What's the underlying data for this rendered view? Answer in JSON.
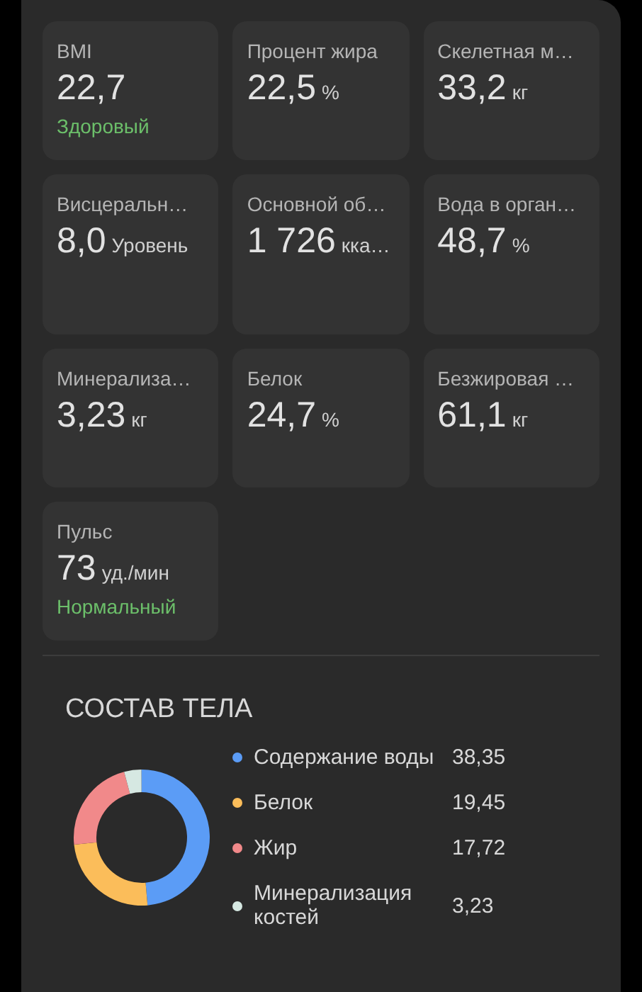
{
  "metrics": [
    {
      "label": "BMI",
      "value": "22,7",
      "status": "Здоровый"
    },
    {
      "label": "Процент жира",
      "value": "22,5",
      "unit": "%"
    },
    {
      "label": "Скелетная м…",
      "value": "33,2",
      "unit": "кг"
    },
    {
      "label": "Висцеральн…",
      "value": "8,0",
      "unit": "Уровень"
    },
    {
      "label": "Основной об…",
      "value": "1 726",
      "unit": "кка…"
    },
    {
      "label": "Вода в орган…",
      "value": "48,7",
      "unit": "%"
    },
    {
      "label": "Минерализа…",
      "value": "3,23",
      "unit": "кг"
    },
    {
      "label": "Белок",
      "value": "24,7",
      "unit": "%"
    },
    {
      "label": "Безжировая …",
      "value": "61,1",
      "unit": "кг"
    },
    {
      "label": "Пульс",
      "value": "73",
      "unit": "уд./мин",
      "status": "Нормальный"
    }
  ],
  "body_composition": {
    "title": "СОСТАВ ТЕЛА",
    "legend": [
      {
        "value": "38,35",
        "color": "#5b9cf6"
      },
      {
        "value": "19,45",
        "color": "#fbbd5a"
      },
      {
        "value": "17,72",
        "color": "#f1898a"
      },
      {
        "value": "3,23",
        "color": "#d6e8e2"
      }
    ],
    "chart_data": {
      "type": "donut",
      "categories": [
        "Содержание воды",
        "Белок",
        "Жир",
        "Минерализация костей"
      ],
      "values": [
        48.7,
        24.7,
        22.5,
        4.1
      ]
    }
  }
}
